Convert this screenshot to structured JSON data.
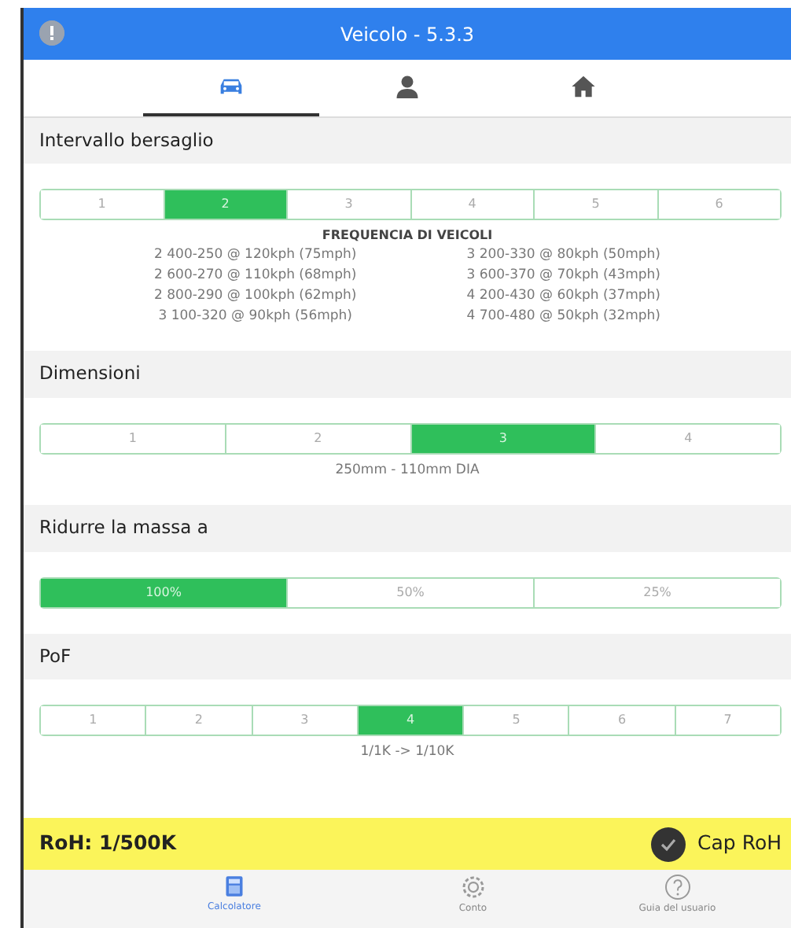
{
  "header": {
    "title": "Veicolo - 5.3.3"
  },
  "tabs": [
    {
      "kind": "car",
      "selected": true
    },
    {
      "kind": "person",
      "selected": false
    },
    {
      "kind": "home",
      "selected": false
    }
  ],
  "sections": [
    {
      "title": "Intervallo bersaglio",
      "options": [
        {
          "label": "1",
          "selected": false
        },
        {
          "label": "2",
          "selected": true
        },
        {
          "label": "3",
          "selected": false
        },
        {
          "label": "4",
          "selected": false
        },
        {
          "label": "5",
          "selected": false
        },
        {
          "label": "6",
          "selected": false
        }
      ],
      "notes_title": "FREQUENCIA DI VEICOLI",
      "notes_columns": [
        [
          "2 400-250 @ 120kph (75mph)",
          "2 600-270 @ 110kph (68mph)",
          "2 800-290 @ 100kph (62mph)",
          "3 100-320 @ 90kph (56mph)"
        ],
        [
          "3 200-330 @ 80kph (50mph)",
          "3 600-370 @ 70kph (43mph)",
          "4 200-430 @ 60kph (37mph)",
          "4 700-480 @ 50kph (32mph)"
        ]
      ]
    },
    {
      "title": "Dimensioni",
      "options": [
        {
          "label": "1",
          "selected": false
        },
        {
          "label": "2",
          "selected": false
        },
        {
          "label": "3",
          "selected": true
        },
        {
          "label": "4",
          "selected": false
        }
      ],
      "note": "250mm - 110mm DIA"
    },
    {
      "title": "Ridurre la massa a",
      "options": [
        {
          "label": "100%",
          "selected": true
        },
        {
          "label": "50%",
          "selected": false
        },
        {
          "label": "25%",
          "selected": false
        }
      ]
    },
    {
      "title": "PoF",
      "options": [
        {
          "label": "1",
          "selected": false
        },
        {
          "label": "2",
          "selected": false
        },
        {
          "label": "3",
          "selected": false
        },
        {
          "label": "4",
          "selected": true
        },
        {
          "label": "5",
          "selected": false
        },
        {
          "label": "6",
          "selected": false
        },
        {
          "label": "7",
          "selected": false
        }
      ],
      "note": "1/1K -> 1/10K"
    }
  ],
  "result": {
    "roh": "RoH: 1/500K",
    "cap": {
      "label": "Cap RoH",
      "checked": true
    }
  },
  "bottom_nav": [
    {
      "kind": "calculator",
      "label": "Calcolatore",
      "selected": true
    },
    {
      "kind": "gear",
      "label": "Conto",
      "selected": false
    },
    {
      "kind": "help",
      "label": "Guia del usuario",
      "selected": false
    }
  ]
}
